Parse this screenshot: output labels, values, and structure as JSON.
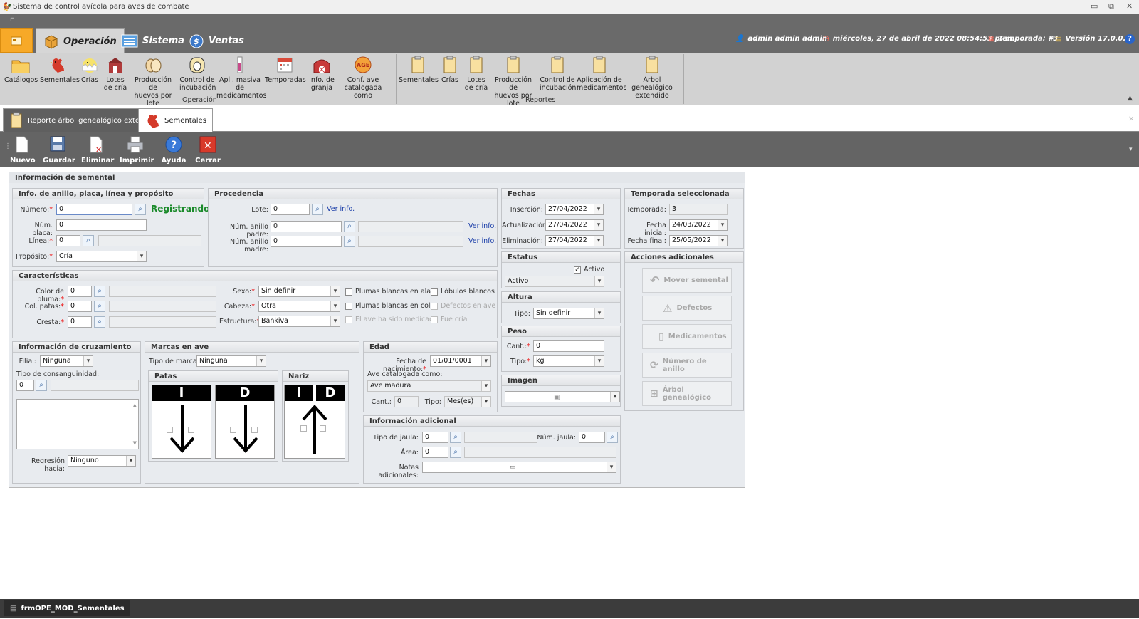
{
  "window": {
    "title": "Sistema de control avícola para aves de combate",
    "controls": [
      "▭",
      "⧉",
      "✕"
    ]
  },
  "header": {
    "tabs": [
      {
        "label": "Operación"
      },
      {
        "label": "Sistema"
      },
      {
        "label": "Ventas"
      }
    ],
    "user": "admin admin admin",
    "datetime": "miércoles, 27 de abril de 2022 08:54:53 p. m.",
    "season": "Temporada: #3",
    "version": "Versión 17.0.0.2"
  },
  "ribbon": {
    "operacion_group_label": "Operación",
    "reportes_group_label": "Reportes",
    "operacion": [
      {
        "l1": "Catálogos",
        "l2": "",
        "icon": "folder-icon"
      },
      {
        "l1": "Sementales",
        "l2": "",
        "icon": "rooster-icon"
      },
      {
        "l1": "Crías",
        "l2": "",
        "icon": "chick-icon"
      },
      {
        "l1": "Lotes",
        "l2": "de cría",
        "icon": "barn-icon"
      },
      {
        "l1": "Producción de",
        "l2": "huevos por lote",
        "icon": "egg-icon"
      },
      {
        "l1": "Control de",
        "l2": "incubación",
        "icon": "incubator-icon"
      },
      {
        "l1": "Apli. masiva de",
        "l2": "medicamentos",
        "icon": "syringe-icon"
      },
      {
        "l1": "Temporadas",
        "l2": "",
        "icon": "calendar-icon"
      },
      {
        "l1": "Info. de",
        "l2": "granja",
        "icon": "farm-icon"
      },
      {
        "l1": "Conf. ave",
        "l2": "catalogada como",
        "icon": "age-icon"
      }
    ],
    "reportes": [
      {
        "l1": "Sementales",
        "l2": ""
      },
      {
        "l1": "Crías",
        "l2": ""
      },
      {
        "l1": "Lotes",
        "l2": "de cría"
      },
      {
        "l1": "Producción de",
        "l2": "huevos por lote"
      },
      {
        "l1": "Control de",
        "l2": "incubación"
      },
      {
        "l1": "Aplicación de",
        "l2": "medicamentos"
      },
      {
        "l1": "Árbol genealógico",
        "l2": "extendido"
      }
    ]
  },
  "doc_tabs": [
    {
      "label": "Reporte árbol genealógico extendido"
    },
    {
      "label": "Sementales"
    }
  ],
  "toolbar": {
    "nuevo": "Nuevo",
    "guardar": "Guardar",
    "eliminar": "Eliminar",
    "imprimir": "Imprimir",
    "ayuda": "Ayuda",
    "cerrar": "Cerrar"
  },
  "form": {
    "title": "Información de semental",
    "anillo": {
      "title": "Info. de anillo, placa, línea y propósito",
      "numero_label": "Número:",
      "numero_value": "0",
      "status": "Registrando",
      "placa_label": "Núm. placa:",
      "placa_value": "0",
      "linea_label": "Línea:",
      "linea_value": "0",
      "proposito_label": "Propósito:",
      "proposito_value": "Cría"
    },
    "procedencia": {
      "title": "Procedencia",
      "lote_label": "Lote:",
      "lote_value": "0",
      "padre_label": "Núm. anillo padre:",
      "padre_value": "0",
      "madre_label": "Núm. anillo madre:",
      "madre_value": "0",
      "ver_info": "Ver info."
    },
    "fechas": {
      "title": "Fechas",
      "insercion_label": "Inserción:",
      "insercion_value": "27/04/2022",
      "actualizacion_label": "Actualización:",
      "actualizacion_value": "27/04/2022",
      "eliminacion_label": "Eliminación:",
      "eliminacion_value": "27/04/2022"
    },
    "temporada": {
      "title": "Temporada seleccionada",
      "temporada_label": "Temporada:",
      "temporada_value": "3",
      "inicial_label": "Fecha inicial:",
      "inicial_value": "24/03/2022",
      "final_label": "Fecha final:",
      "final_value": "25/05/2022"
    },
    "caracteristicas": {
      "title": "Características",
      "pluma_label": "Color de pluma:",
      "pluma_value": "0",
      "patas_label": "Col. patas:",
      "patas_value": "0",
      "cresta_label": "Cresta:",
      "cresta_value": "0",
      "sexo_label": "Sexo:",
      "sexo_value": "Sin definir",
      "cabeza_label": "Cabeza:",
      "cabeza_value": "Otra",
      "estructura_label": "Estructura:",
      "estructura_value": "Bankiva",
      "chk_plumas_alas": "Plumas blancas en alas",
      "chk_plumas_cola": "Plumas blancas en cola",
      "chk_medicada": "El ave ha sido medicada",
      "chk_lobulos": "Lóbulos blancos",
      "chk_defectos": "Defectos en ave",
      "chk_fue_cria": "Fue cría"
    },
    "estatus": {
      "title": "Estatus",
      "activo_label": "Activo",
      "activo_checked": true,
      "value": "Activo"
    },
    "altura": {
      "title": "Altura",
      "tipo_label": "Tipo:",
      "tipo_value": "Sin definir"
    },
    "peso": {
      "title": "Peso",
      "cant_label": "Cant.:",
      "cant_value": "0",
      "tipo_label": "Tipo:",
      "tipo_value": "kg"
    },
    "imagen": {
      "title": "Imagen"
    },
    "acciones": {
      "title": "Acciones adicionales",
      "mover": "Mover semental",
      "defectos": "Defectos",
      "medicamentos": "Medicamentos",
      "numero_anillo": "Número de anillo",
      "arbol": "Árbol genealógico"
    },
    "cruzamiento": {
      "title": "Información de cruzamiento",
      "filial_label": "Filial:",
      "filial_value": "Ninguna",
      "consanguinidad_label": "Tipo de consanguinidad:",
      "consanguinidad_value": "0",
      "regresion_label": "Regresión hacia:",
      "regresion_value": "Ninguno"
    },
    "marcas": {
      "title": "Marcas en ave",
      "tipo_label": "Tipo de marca :",
      "tipo_value": "Ninguna",
      "patas_title": "Patas",
      "nariz_title": "Nariz",
      "left": "I",
      "right": "D"
    },
    "edad": {
      "title": "Edad",
      "nacimiento_label": "Fecha de nacimiento:",
      "nacimiento_value": "01/01/0001",
      "catalogada_label": "Ave catalogada como:",
      "catalogada_value": "Ave madura",
      "cant_label": "Cant.:",
      "cant_value": "0",
      "tipo_label": "Tipo:",
      "tipo_value": "Mes(es)"
    },
    "adicional": {
      "title": "Información adicional",
      "jaula_label": "Tipo de jaula:",
      "jaula_value": "0",
      "num_jaula_label": "Núm. jaula:",
      "num_jaula_value": "0",
      "area_label": "Área:",
      "area_value": "0",
      "notas_label": "Notas adicionales:"
    }
  },
  "statusbar": {
    "form_name": "frmOPE_MOD_Sementales"
  }
}
